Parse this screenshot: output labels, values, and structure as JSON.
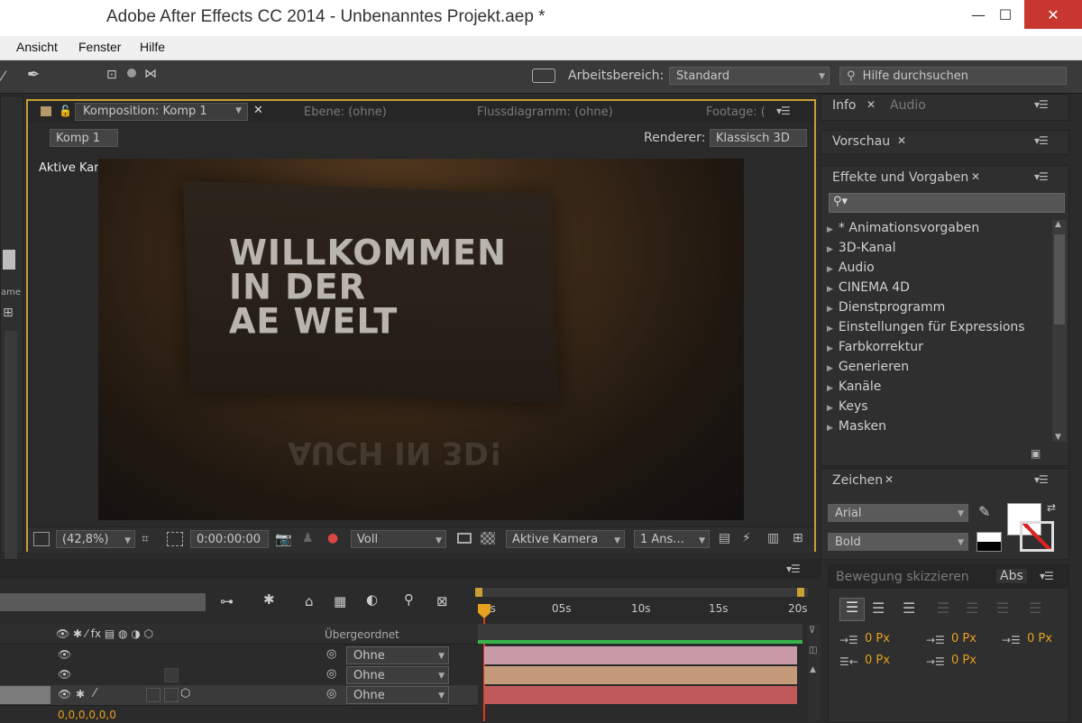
{
  "window": {
    "title": "Adobe After Effects CC 2014 - Unbenanntes Projekt.aep *",
    "minimize": "—",
    "maximize": "☐",
    "close": "✕"
  },
  "menu": [
    "Ansicht",
    "Fenster",
    "Hilfe"
  ],
  "toolbar": {
    "workspace_label": "Arbeitsbereich:",
    "workspace_value": "Standard",
    "help_placeholder": "Hilfe durchsuchen"
  },
  "composition": {
    "tabs": [
      "Komposition: Komp 1",
      "Ebene: (ohne)",
      "Flussdiagramm: (ohne)",
      "Footage: ("
    ],
    "breadcrumb": "Komp 1",
    "renderer_label": "Renderer:",
    "renderer_value": "Klassisch 3D",
    "camera_label": "Aktive Kamera",
    "viewer_lines": [
      "WILLKOMMEN",
      "IN DER",
      "AE WELT"
    ],
    "reflection_text": "AUCH IN 3D!",
    "footer": {
      "zoom": "(42,8%)",
      "timecode": "0:00:00:00",
      "resolution": "Voll",
      "camera": "Aktive Kamera",
      "views": "1 Ans..."
    }
  },
  "right_panels": {
    "info_tab": "Info",
    "audio_tab": "Audio",
    "preview_tab": "Vorschau",
    "effects_tab": "Effekte und Vorgaben",
    "effects_list": [
      "* Animationsvorgaben",
      "3D-Kanal",
      "Audio",
      "CINEMA 4D",
      "Dienstprogramm",
      "Einstellungen für Expressions",
      "Farbkorrektur",
      "Generieren",
      "Kanäle",
      "Keys",
      "Masken"
    ],
    "character_tab": "Zeichen",
    "font": "Arial",
    "style": "Bold",
    "motion_tab": "Bewegung skizzieren",
    "abs_tab": "Abs",
    "px_values": [
      "0 Px",
      "0 Px",
      "0 Px",
      "0 Px",
      "0 Px"
    ]
  },
  "timeline": {
    "ruler": [
      "0s",
      "05s",
      "10s",
      "15s",
      "20s"
    ],
    "parent_header": "Übergeordnet",
    "parent_values": [
      "Ohne",
      "Ohne",
      "Ohne"
    ],
    "footer_value": "0,0,0,0,0,0"
  },
  "colors": {
    "accent": "#c9a034",
    "bar1": "#c89aa8",
    "bar2": "#c49a7a",
    "bar3": "#c05a5a",
    "playhead": "#e8a020",
    "workarea": "#36b34a"
  }
}
